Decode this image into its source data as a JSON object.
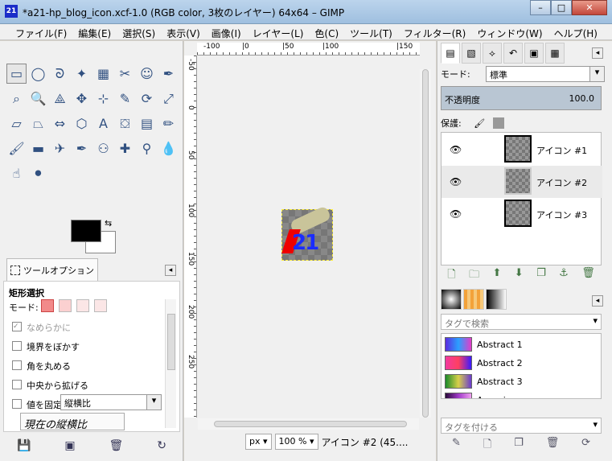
{
  "window": {
    "title": "*a21-hp_blog_icon.xcf-1.0 (RGB color, 3枚のレイヤー) 64x64 – GIMP",
    "app_icon_text": "21",
    "buttons": [
      "–",
      "□",
      "✕"
    ]
  },
  "menu": [
    "ファイル(F)",
    "編集(E)",
    "選択(S)",
    "表示(V)",
    "画像(I)",
    "レイヤー(L)",
    "色(C)",
    "ツール(T)",
    "フィルター(R)",
    "ウィンドウ(W)",
    "ヘルプ(H)"
  ],
  "toolbox": {
    "tools": [
      {
        "name": "rect-select-icon",
        "glyph": "▭"
      },
      {
        "name": "ellipse-select-icon",
        "glyph": "◯"
      },
      {
        "name": "lasso-icon",
        "glyph": "ᘐ"
      },
      {
        "name": "fuzzy-select-icon",
        "glyph": "✦"
      },
      {
        "name": "color-select-icon",
        "glyph": "▦"
      },
      {
        "name": "scissors-icon",
        "glyph": "✂"
      },
      {
        "name": "foreground-select-icon",
        "glyph": "☺"
      },
      {
        "name": "paths-icon",
        "glyph": "✒"
      },
      {
        "name": "color-picker-icon",
        "glyph": "⌕"
      },
      {
        "name": "zoom-icon",
        "glyph": "🔍"
      },
      {
        "name": "measure-icon",
        "glyph": "⟁"
      },
      {
        "name": "move-icon",
        "glyph": "✥"
      },
      {
        "name": "align-icon",
        "glyph": "⊹"
      },
      {
        "name": "crop-icon",
        "glyph": "✎"
      },
      {
        "name": "rotate-icon",
        "glyph": "⟳"
      },
      {
        "name": "scale-icon",
        "glyph": "⤢"
      },
      {
        "name": "shear-icon",
        "glyph": "▱"
      },
      {
        "name": "perspective-icon",
        "glyph": "⏢"
      },
      {
        "name": "flip-icon",
        "glyph": "⇔"
      },
      {
        "name": "cage-icon",
        "glyph": "⬡"
      },
      {
        "name": "text-icon",
        "glyph": "A"
      },
      {
        "name": "bucket-fill-icon",
        "glyph": "⛋"
      },
      {
        "name": "blend-icon",
        "glyph": "▤"
      },
      {
        "name": "pencil-icon",
        "glyph": "✏"
      },
      {
        "name": "paintbrush-icon",
        "glyph": "🖌"
      },
      {
        "name": "eraser-icon",
        "glyph": "▬"
      },
      {
        "name": "airbrush-icon",
        "glyph": "✈"
      },
      {
        "name": "ink-icon",
        "glyph": "✒"
      },
      {
        "name": "clone-icon",
        "glyph": "⚇"
      },
      {
        "name": "heal-icon",
        "glyph": "✚"
      },
      {
        "name": "perspective-clone-icon",
        "glyph": "⚲"
      },
      {
        "name": "blur-icon",
        "glyph": "💧"
      },
      {
        "name": "smudge-icon",
        "glyph": "☝"
      },
      {
        "name": "dodge-burn-icon",
        "glyph": "⚫"
      }
    ],
    "options_tab": "ツールオプション",
    "options_title": "矩形選択",
    "mode_label": "モード:",
    "checkboxes": [
      {
        "label": "なめらかに",
        "checked": true,
        "disabled": true
      },
      {
        "label": "境界をぼかす",
        "checked": false,
        "disabled": false
      },
      {
        "label": "角を丸める",
        "checked": false,
        "disabled": false
      },
      {
        "label": "中央から拡げる",
        "checked": false,
        "disabled": false
      },
      {
        "label": "値を固定",
        "checked": false,
        "disabled": false
      }
    ],
    "fixed_combo": "縦横比",
    "ratio_value": "現在の縦横比",
    "bottom_icons": [
      "save-icon",
      "restore-icon",
      "delete-icon",
      "reset-icon"
    ]
  },
  "canvas": {
    "hruler_labels": [
      "-100",
      "|0",
      "|50",
      "|100",
      "|150"
    ],
    "vruler_labels": [
      "-50",
      "0",
      "50",
      "100",
      "150",
      "200",
      "250"
    ],
    "unit": "px",
    "zoom": "100 %",
    "status": "アイコン #2 (45...."
  },
  "layers": {
    "mode_label": "モード:",
    "mode_value": "標準",
    "opacity_label": "不透明度",
    "opacity_value": "100.0",
    "lock_label": "保護:",
    "items": [
      {
        "name": "アイコン #1",
        "selected": false
      },
      {
        "name": "アイコン #2",
        "selected": true
      },
      {
        "name": "アイコン #3",
        "selected": false
      }
    ]
  },
  "gradients": {
    "search_placeholder": "タグで検索",
    "items": [
      {
        "name": "Abstract 1",
        "colors": "linear-gradient(90deg,#5a2de0,#2aa0ff,#e43cc8)"
      },
      {
        "name": "Abstract 2",
        "colors": "linear-gradient(90deg,#f23aa0,#ff4060,#3a1aff)"
      },
      {
        "name": "Abstract 3",
        "colors": "linear-gradient(90deg,#1a8a2a,#d8d04a,#6a3ad0)"
      },
      {
        "name": "Aneurism",
        "colors": "linear-gradient(90deg,#2a0a3a,#a03ac8,#f0a0f0)"
      }
    ],
    "tag_placeholder": "タグを付ける"
  }
}
